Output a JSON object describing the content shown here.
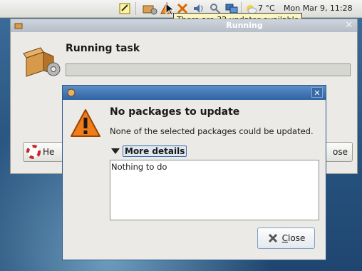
{
  "panel": {
    "temperature": "7 °C",
    "clock": "Mon Mar  9, 11:28",
    "icons": [
      "notes-icon",
      "package-updater-icon",
      "update-alert-icon",
      "network-disconnected-icon",
      "volume-icon",
      "tools-icon",
      "display-icon",
      "weather-icon"
    ]
  },
  "tooltip": {
    "text": "There are 32 updates available"
  },
  "bg_window": {
    "title": "Running",
    "task_title": "Running task",
    "progress_fraction": 0.0,
    "help_label": "He",
    "close_label": "ose"
  },
  "dialog": {
    "heading": "No packages to update",
    "message": "None of the selected packages could be updated.",
    "expander_label": "More details",
    "details_text": "Nothing to do",
    "close_label": "Close",
    "close_underline": "C",
    "close_rest": "lose"
  },
  "colors": {
    "dialog_title": "#2e63a3",
    "warning": "#f07c1a",
    "tooltip_bg": "#fbf5c2"
  }
}
